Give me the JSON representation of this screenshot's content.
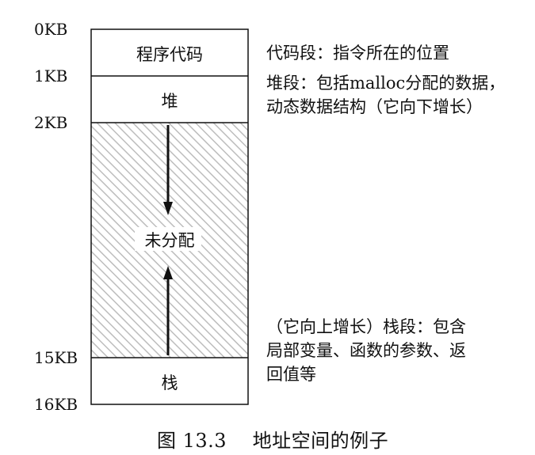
{
  "addresses": {
    "a0": "0KB",
    "a1": "1KB",
    "a2": "2KB",
    "a15": "15KB",
    "a16": "16KB"
  },
  "segments": {
    "code": "程序代码",
    "heap": "堆",
    "free": "未分配",
    "stack": "栈"
  },
  "descriptions": {
    "code": "代码段：指令所在的位置",
    "heap_line1": "堆段：包括malloc分配的数据，",
    "heap_line2": "动态数据结构（它向下增长）",
    "stack_line1": "（它向上增长）栈段：包含",
    "stack_line2": "局部变量、函数的参数、返",
    "stack_line3": "回值等"
  },
  "caption": "图 13.3    地址空间的例子"
}
